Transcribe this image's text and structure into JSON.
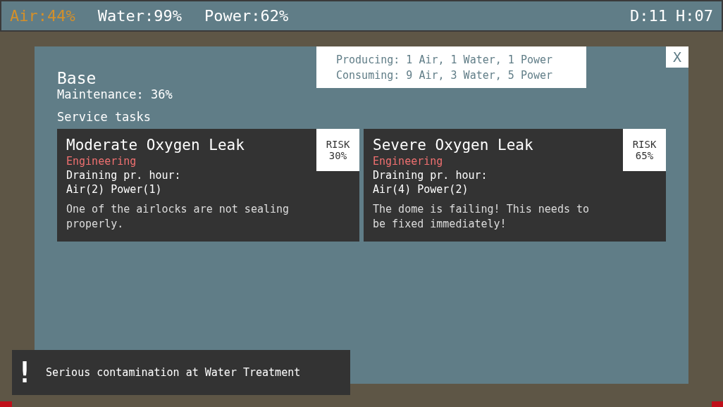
{
  "resources": [
    {
      "label": "Air:44%",
      "warning": true
    },
    {
      "label": "Water:99%",
      "warning": false
    },
    {
      "label": "Power:62%",
      "warning": false
    }
  ],
  "clock": {
    "day": "D:11",
    "hour": "H:07"
  },
  "panel": {
    "close": "X",
    "stats": [
      "Producing: 1 Air, 1 Water, 1 Power",
      "Consuming: 9 Air, 3 Water, 5 Power"
    ],
    "title": "Base",
    "maintenance": "Maintenance: 36%",
    "section": "Service tasks",
    "tasks": [
      {
        "title": "Moderate Oxygen Leak",
        "department": "Engineering",
        "draining_label": "Draining pr. hour:",
        "draining": "Air(2) Power(1)",
        "description": "One of the airlocks are not sealing properly.",
        "risk_label": "RISK",
        "risk": "30%"
      },
      {
        "title": "Severe Oxygen Leak",
        "department": "Engineering",
        "draining_label": "Draining pr. hour:",
        "draining": "Air(4) Power(2)",
        "description": "The dome is failing! This needs to be fixed immediately!",
        "risk_label": "RISK",
        "risk": "65%"
      }
    ]
  },
  "notification": {
    "icon": "!",
    "text": "Serious contamination at Water Treatment"
  }
}
